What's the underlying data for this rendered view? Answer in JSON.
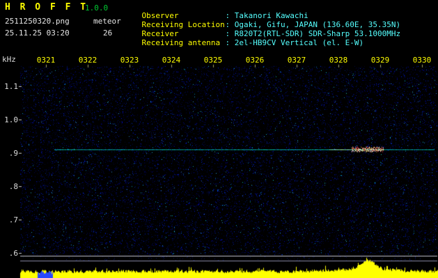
{
  "app": {
    "title": "H R O F F T",
    "version": "1.0.0",
    "filename": "2511250320.png",
    "mode": "meteor",
    "datetime": "25.11.25 03:20",
    "count": "26"
  },
  "info": {
    "rows": [
      {
        "label": "Observer",
        "value": ": Takanori Kawachi"
      },
      {
        "label": "Receiving Location",
        "value": ": Ogaki, Gifu, JAPAN (136.60E, 35.35N)"
      },
      {
        "label": "Receiver",
        "value": ": R820T2(RTL-SDR) SDR-Sharp 53.1000MHz"
      },
      {
        "label": "Receiving antenna",
        "value": ": 2el-HB9CV Vertical (el. E-W)"
      }
    ]
  },
  "chart_data": {
    "type": "heatmap",
    "title": "HROFFT meteor radio spectrogram 2511250320",
    "x_axis": {
      "tick_labels": [
        "0321",
        "0322",
        "0323",
        "0324",
        "0325",
        "0326",
        "0327",
        "0328",
        "0329",
        "0330"
      ],
      "unit": "hhmm (JST)",
      "range": [
        "03:20",
        "03:30"
      ]
    },
    "y_axis": {
      "unit": "kHz",
      "tick_labels": [
        "1.1",
        "1.0",
        ".9",
        ".8",
        ".7",
        ".6"
      ],
      "range": [
        0.55,
        1.15
      ]
    },
    "carrier": {
      "frequency_khz": 0.91,
      "start_min": 1.2,
      "end_min": 10.3,
      "color": "#00e6b8"
    },
    "meteor_echo": {
      "center_min": 8.7,
      "frequency_khz": 0.91,
      "half_width_min": 0.5,
      "colors": [
        "#ffffff",
        "#ff4040",
        "#ffe080"
      ]
    },
    "noise_floor_color": "#0a1a66",
    "background": "#000000",
    "amplitude_strip": {
      "color": "#ffff00",
      "peak_min": 8.7,
      "interference_patch": {
        "start_min": 0.8,
        "end_min": 1.15,
        "color": "#2846ff"
      }
    }
  }
}
